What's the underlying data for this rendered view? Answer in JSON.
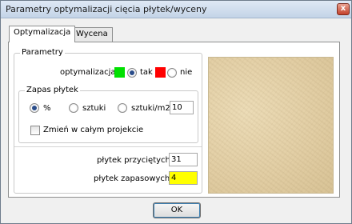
{
  "window": {
    "title": "Parametry optymalizacji cięcia płytek/wyceny",
    "close_glyph": "x"
  },
  "tabs": [
    {
      "label": "Optymalizacja",
      "active": true
    },
    {
      "label": "Wycena",
      "active": false
    }
  ],
  "parametry": {
    "group_title": "Parametry",
    "optymalizacja_label": "optymalizacja",
    "option_yes": {
      "label": "tak",
      "color": "#00e000",
      "selected": true
    },
    "option_no": {
      "label": "nie",
      "color": "#ff0000",
      "selected": false
    }
  },
  "zapas": {
    "group_title": "Zapas płytek",
    "unit_percent": {
      "label": "%",
      "selected": true
    },
    "unit_pieces": {
      "label": "sztuki",
      "selected": false
    },
    "unit_per_m2": {
      "label": "sztuki/m2",
      "selected": false
    },
    "amount_value": "10",
    "apply_all_label": "Zmień w całym projekcie",
    "apply_all_checked": false
  },
  "summary": {
    "cut_label": "płytek przyciętych",
    "cut_value": "31",
    "spare_label": "płytek zapasowych",
    "spare_value": "4",
    "spare_highlight": "#ffff00"
  },
  "preview": {
    "texture_name": "beige-stone-texture"
  },
  "buttons": {
    "ok_label": "OK"
  }
}
